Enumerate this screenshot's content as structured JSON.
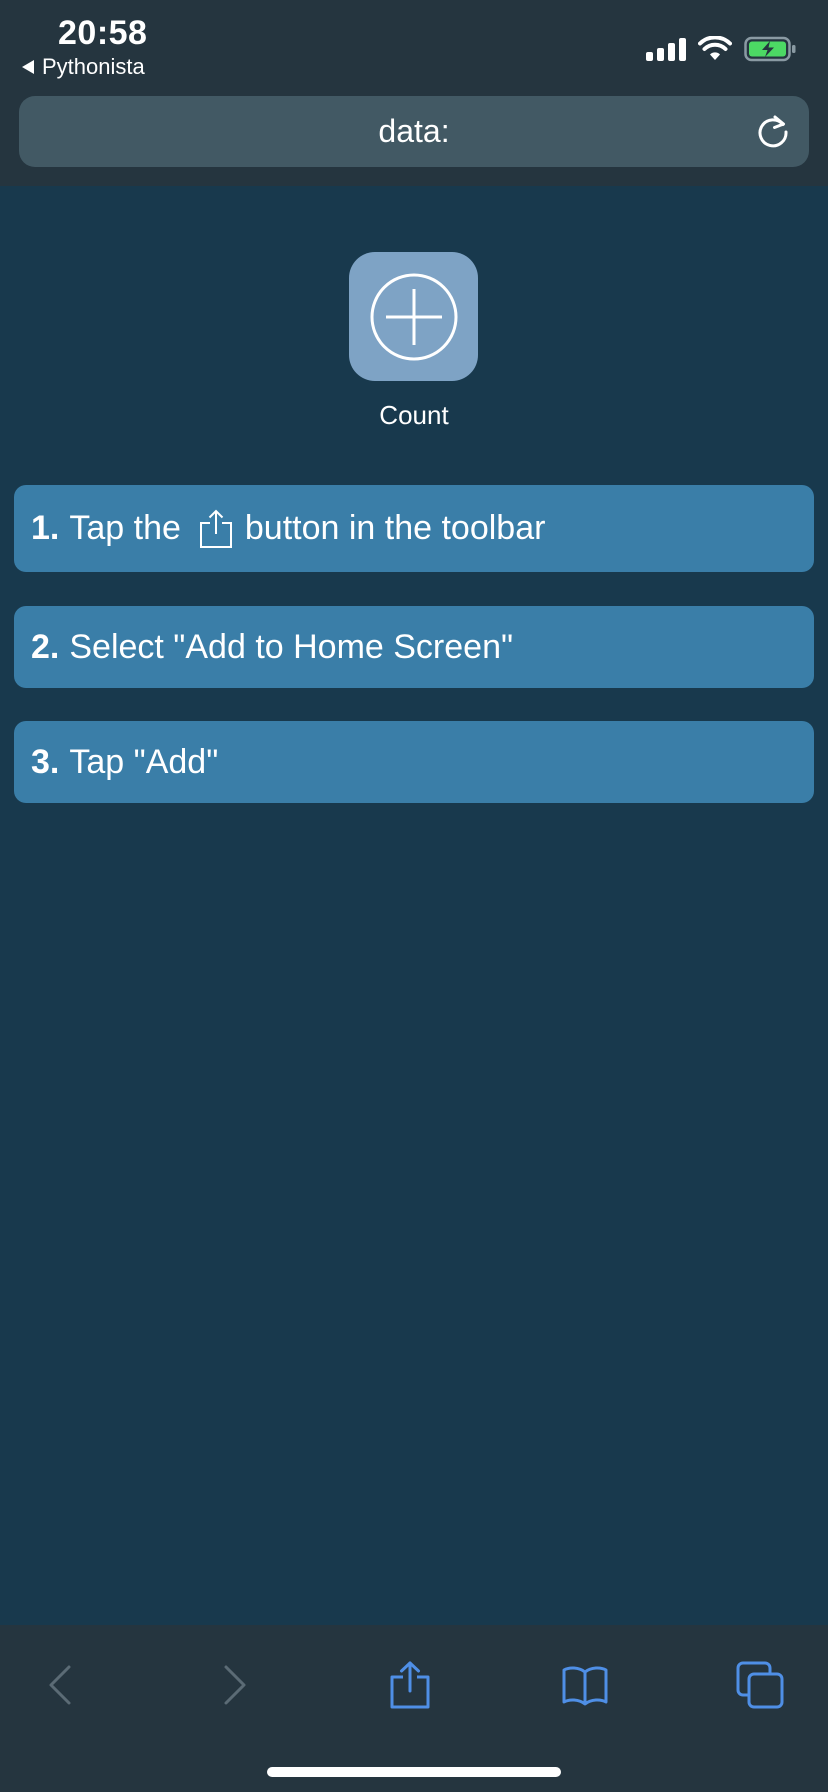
{
  "status_bar": {
    "time": "20:58",
    "back_app": "Pythonista",
    "battery_color": "#4cd964"
  },
  "url_bar": {
    "text": "data:"
  },
  "app": {
    "name": "Count",
    "icon": "plus-circle-icon",
    "icon_bg": "#7ea3c5"
  },
  "steps": [
    {
      "num": "1.",
      "text_before": "Tap the",
      "icon": "share-icon",
      "text_after": "button in the toolbar"
    },
    {
      "num": "2.",
      "text": "Select \"Add to Home Screen\""
    },
    {
      "num": "3.",
      "text": "Tap \"Add\""
    }
  ],
  "colors": {
    "background": "#18394d",
    "chrome": "#25353f",
    "step_bg": "#3a7ea8",
    "toolbar_active": "#4f8fe6",
    "toolbar_disabled": "#5b6b75"
  },
  "toolbar": {
    "items": [
      {
        "icon": "chevron-left-icon",
        "enabled": false
      },
      {
        "icon": "chevron-right-icon",
        "enabled": false
      },
      {
        "icon": "share-icon",
        "enabled": true
      },
      {
        "icon": "bookmarks-book-icon",
        "enabled": true
      },
      {
        "icon": "tabs-icon",
        "enabled": true
      }
    ]
  }
}
